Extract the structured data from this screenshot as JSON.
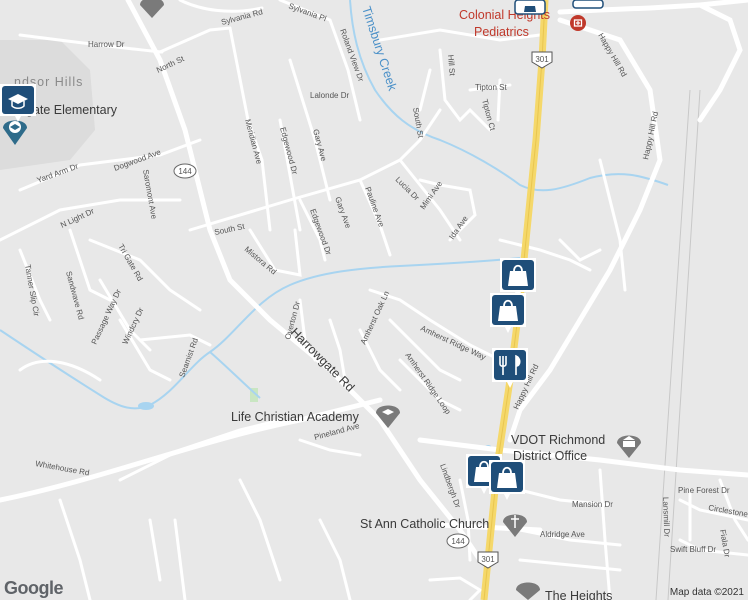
{
  "map": {
    "attribution": "Map data ©2021",
    "logo": "Google",
    "area_label": "Colonial Heights"
  },
  "roads": {
    "sylvania_rd": "Sylvania Rd",
    "sylvania_pl": "Sylvania Pl",
    "harrow_dr": "Harrow Dr",
    "north_st": "North St",
    "roland_view_dr": "Roland View Dr",
    "lalonde_dr": "Lalonde Dr",
    "meridian_ave": "Meridian Ave",
    "edgewood_dr": "Edgewood Dr",
    "gary_ave": "Gary Ave",
    "hill_st": "Hill St",
    "tipton_st": "Tipton St",
    "tipton_ct": "Tipton Ct",
    "south_st": "South St",
    "yard_arm_dr": "Yard Arm Dr",
    "dogwood_ave": "Dogwood Ave",
    "saromont_ave": "Saromont Ave",
    "n_light_dr": "N Light Dr",
    "route_144": "144",
    "route_301": "301",
    "pauline_ave": "Pauline Ave",
    "lucia_dr": "Lucia Dr",
    "mimi_ave": "Mimi Ave",
    "ida_ave": "Ida Ave",
    "gary_ave_2": "Gary Ave",
    "edgewood_dr_2": "Edgewood Dr",
    "tri_gate_rd": "Tri Gate Rd",
    "tanner_slip_cir": "Tanner Slip Cir",
    "sandwave_rd": "Sandwave Rd",
    "mistora_rd": "Mistora Rd",
    "passage_way_dr": "Passage Way Dr",
    "windcry_dr": "Windcry Dr",
    "seamist_rd": "Seamist Rd",
    "overton_dr": "Overton Dr",
    "harrowgate_rd": "Harrowgate Rd",
    "amherst_oak_ln": "Amherst Oak Ln",
    "amherst_ridge_way": "Amherst Ridge Way",
    "amherst_ridge_loop": "Amherst Ridge Loop",
    "happy_hill_rd": "Happy Hill Rd",
    "happy_hill_rd_2": "Happy Hill Rd",
    "happy_hill_rd_3": "Happy Hill Rd",
    "timsbury_creek": "Timsbury Creek",
    "whitehouse_rd": "Whitehouse Rd",
    "pineland_ave": "Pineland Ave",
    "lindbergh_dr": "Lindbergh Dr",
    "mansion_dr": "Mansion Dr",
    "pine_forest_dr": "Pine Forest Dr",
    "lansmill_dr": "Lansmill Dr",
    "circlestone_dr": "Circlestone Dr",
    "fiala_dr": "Fiala Dr",
    "aldridge_ave": "Aldridge Ave",
    "swift_bluff_dr": "Swift Bluff Dr"
  },
  "pois": {
    "pediatrics_line1": "Colonial Heights",
    "pediatrics_line2": "Pediatrics",
    "windsor_hills": "ndsor Hills",
    "elementary": "gate Elementary",
    "life_christian": "Life Christian Academy",
    "vdot_line1": "VDOT Richmond",
    "vdot_line2": "District Office",
    "st_ann": "St Ann Catholic Church",
    "the_heights": "The Heights"
  },
  "colors": {
    "background": "#e8e8e8",
    "road": "#ffffff",
    "highway": "#f5d86a",
    "water": "#a8d4f0",
    "park": "#c9e6c2",
    "pin": "#1f4e79",
    "poi_red": "#c0392b"
  },
  "icons": [
    "shopping-bag-icon",
    "restaurant-icon",
    "school-icon",
    "church-icon",
    "museum-icon",
    "hospital-icon"
  ]
}
